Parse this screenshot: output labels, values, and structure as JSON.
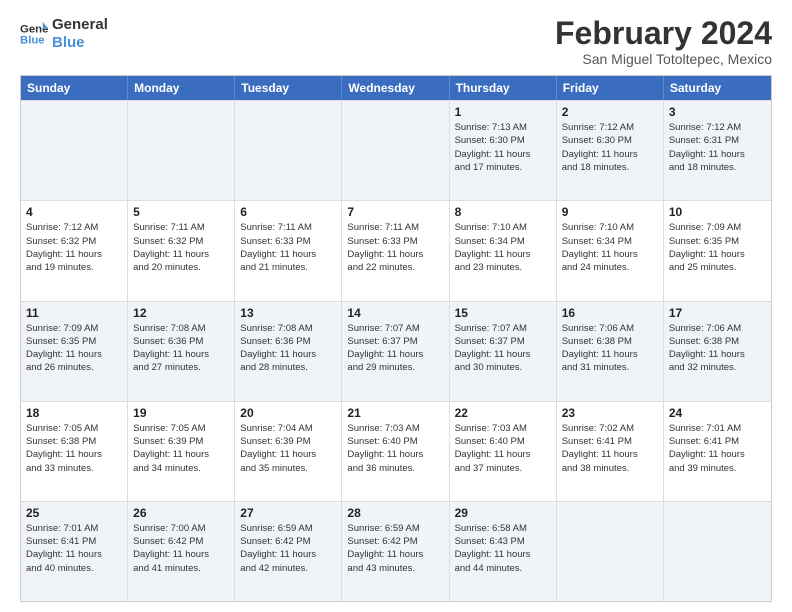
{
  "logo": {
    "line1": "General",
    "line2": "Blue"
  },
  "title": "February 2024",
  "subtitle": "San Miguel Totoltepec, Mexico",
  "days_of_week": [
    "Sunday",
    "Monday",
    "Tuesday",
    "Wednesday",
    "Thursday",
    "Friday",
    "Saturday"
  ],
  "weeks": [
    [
      {
        "day": "",
        "info": ""
      },
      {
        "day": "",
        "info": ""
      },
      {
        "day": "",
        "info": ""
      },
      {
        "day": "",
        "info": ""
      },
      {
        "day": "1",
        "info": "Sunrise: 7:13 AM\nSunset: 6:30 PM\nDaylight: 11 hours\nand 17 minutes."
      },
      {
        "day": "2",
        "info": "Sunrise: 7:12 AM\nSunset: 6:30 PM\nDaylight: 11 hours\nand 18 minutes."
      },
      {
        "day": "3",
        "info": "Sunrise: 7:12 AM\nSunset: 6:31 PM\nDaylight: 11 hours\nand 18 minutes."
      }
    ],
    [
      {
        "day": "4",
        "info": "Sunrise: 7:12 AM\nSunset: 6:32 PM\nDaylight: 11 hours\nand 19 minutes."
      },
      {
        "day": "5",
        "info": "Sunrise: 7:11 AM\nSunset: 6:32 PM\nDaylight: 11 hours\nand 20 minutes."
      },
      {
        "day": "6",
        "info": "Sunrise: 7:11 AM\nSunset: 6:33 PM\nDaylight: 11 hours\nand 21 minutes."
      },
      {
        "day": "7",
        "info": "Sunrise: 7:11 AM\nSunset: 6:33 PM\nDaylight: 11 hours\nand 22 minutes."
      },
      {
        "day": "8",
        "info": "Sunrise: 7:10 AM\nSunset: 6:34 PM\nDaylight: 11 hours\nand 23 minutes."
      },
      {
        "day": "9",
        "info": "Sunrise: 7:10 AM\nSunset: 6:34 PM\nDaylight: 11 hours\nand 24 minutes."
      },
      {
        "day": "10",
        "info": "Sunrise: 7:09 AM\nSunset: 6:35 PM\nDaylight: 11 hours\nand 25 minutes."
      }
    ],
    [
      {
        "day": "11",
        "info": "Sunrise: 7:09 AM\nSunset: 6:35 PM\nDaylight: 11 hours\nand 26 minutes."
      },
      {
        "day": "12",
        "info": "Sunrise: 7:08 AM\nSunset: 6:36 PM\nDaylight: 11 hours\nand 27 minutes."
      },
      {
        "day": "13",
        "info": "Sunrise: 7:08 AM\nSunset: 6:36 PM\nDaylight: 11 hours\nand 28 minutes."
      },
      {
        "day": "14",
        "info": "Sunrise: 7:07 AM\nSunset: 6:37 PM\nDaylight: 11 hours\nand 29 minutes."
      },
      {
        "day": "15",
        "info": "Sunrise: 7:07 AM\nSunset: 6:37 PM\nDaylight: 11 hours\nand 30 minutes."
      },
      {
        "day": "16",
        "info": "Sunrise: 7:06 AM\nSunset: 6:38 PM\nDaylight: 11 hours\nand 31 minutes."
      },
      {
        "day": "17",
        "info": "Sunrise: 7:06 AM\nSunset: 6:38 PM\nDaylight: 11 hours\nand 32 minutes."
      }
    ],
    [
      {
        "day": "18",
        "info": "Sunrise: 7:05 AM\nSunset: 6:38 PM\nDaylight: 11 hours\nand 33 minutes."
      },
      {
        "day": "19",
        "info": "Sunrise: 7:05 AM\nSunset: 6:39 PM\nDaylight: 11 hours\nand 34 minutes."
      },
      {
        "day": "20",
        "info": "Sunrise: 7:04 AM\nSunset: 6:39 PM\nDaylight: 11 hours\nand 35 minutes."
      },
      {
        "day": "21",
        "info": "Sunrise: 7:03 AM\nSunset: 6:40 PM\nDaylight: 11 hours\nand 36 minutes."
      },
      {
        "day": "22",
        "info": "Sunrise: 7:03 AM\nSunset: 6:40 PM\nDaylight: 11 hours\nand 37 minutes."
      },
      {
        "day": "23",
        "info": "Sunrise: 7:02 AM\nSunset: 6:41 PM\nDaylight: 11 hours\nand 38 minutes."
      },
      {
        "day": "24",
        "info": "Sunrise: 7:01 AM\nSunset: 6:41 PM\nDaylight: 11 hours\nand 39 minutes."
      }
    ],
    [
      {
        "day": "25",
        "info": "Sunrise: 7:01 AM\nSunset: 6:41 PM\nDaylight: 11 hours\nand 40 minutes."
      },
      {
        "day": "26",
        "info": "Sunrise: 7:00 AM\nSunset: 6:42 PM\nDaylight: 11 hours\nand 41 minutes."
      },
      {
        "day": "27",
        "info": "Sunrise: 6:59 AM\nSunset: 6:42 PM\nDaylight: 11 hours\nand 42 minutes."
      },
      {
        "day": "28",
        "info": "Sunrise: 6:59 AM\nSunset: 6:42 PM\nDaylight: 11 hours\nand 43 minutes."
      },
      {
        "day": "29",
        "info": "Sunrise: 6:58 AM\nSunset: 6:43 PM\nDaylight: 11 hours\nand 44 minutes."
      },
      {
        "day": "",
        "info": ""
      },
      {
        "day": "",
        "info": ""
      }
    ]
  ],
  "alt_weeks": [
    0,
    2,
    4
  ]
}
